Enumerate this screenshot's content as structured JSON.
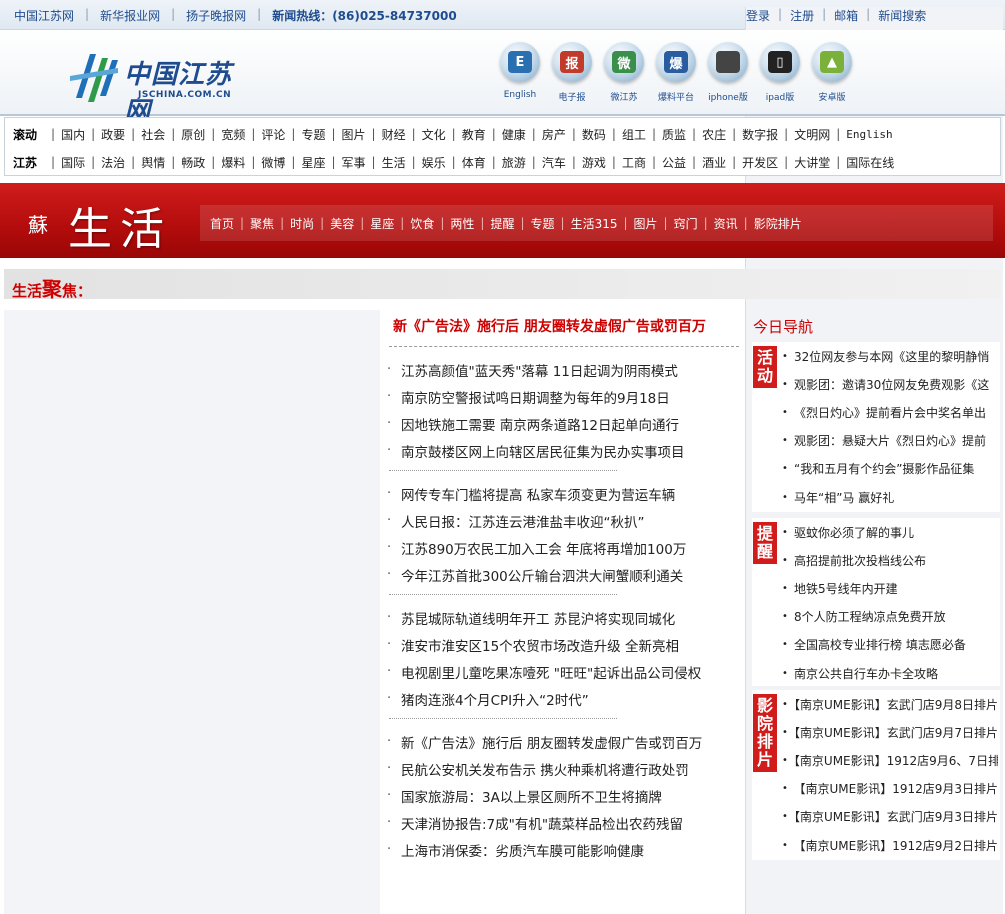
{
  "topbar": {
    "links": [
      "中国江苏网",
      "新华报业网",
      "扬子晚报网"
    ],
    "hotline": "新闻热线：(86)025-84737000",
    "right_links": [
      "登录",
      "注册",
      "邮箱",
      "新闻搜索"
    ]
  },
  "logo": {
    "cn": "中国江苏网",
    "en": "JSCHINA.COM.CN"
  },
  "apps": [
    {
      "label": "English",
      "icon": "english-app-icon",
      "glyph": "E",
      "color": "#2a6fb0"
    },
    {
      "label": "电子报",
      "icon": "epaper-icon",
      "glyph": "报",
      "color": "#c23a2a"
    },
    {
      "label": "微江苏",
      "icon": "weijiangsu-icon",
      "glyph": "微",
      "color": "#3a8f4a"
    },
    {
      "label": "爆料平台",
      "icon": "tipoff-icon",
      "glyph": "爆",
      "color": "#2a5da0"
    },
    {
      "label": "iphone版",
      "icon": "apple-icon",
      "glyph": "",
      "color": "#444444"
    },
    {
      "label": "ipad版",
      "icon": "ipad-icon",
      "glyph": "▯",
      "color": "#222222"
    },
    {
      "label": "安卓版",
      "icon": "android-icon",
      "glyph": "▲",
      "color": "#7bb13a"
    }
  ],
  "nav": {
    "row1_lead": "滚动",
    "row1": [
      "国内",
      "政要",
      "社会",
      "原创",
      "宽频",
      "评论",
      "专题",
      "图片",
      "财经",
      "文化",
      "教育",
      "健康",
      "房产",
      "数码",
      "组工",
      "质监",
      "农庄",
      "数字报",
      "文明网",
      "English"
    ],
    "row2_lead": "江苏",
    "row2": [
      "国际",
      "法治",
      "舆情",
      "畅政",
      "爆料",
      "微博",
      "星座",
      "军事",
      "生活",
      "娱乐",
      "体育",
      "旅游",
      "汽车",
      "游戏",
      "工商",
      "公益",
      "酒业",
      "开发区",
      "大讲堂",
      "国际在线"
    ]
  },
  "banner": {
    "su": "蘇",
    "title": "生活",
    "subnav": [
      "首页",
      "聚焦",
      "时尚",
      "美容",
      "星座",
      "饮食",
      "两性",
      "提醒",
      "专题",
      "生活315",
      "图片",
      "窍门",
      "资讯",
      "影院排片"
    ]
  },
  "focus": {
    "pre": "生活",
    "big": "聚",
    "post": "焦："
  },
  "news": {
    "headline": "新《广告法》施行后  朋友圈转发虚假广告或罚百万",
    "groups": [
      [
        "江苏高颜值\"蓝天秀\"落幕  11日起调为阴雨模式",
        "南京防空警报试鸣日期调整为每年的9月18日",
        "因地铁施工需要  南京两条道路12日起单向通行",
        "南京鼓楼区网上向辖区居民征集为民办实事项目"
      ],
      [
        "网传专车门槛将提高  私家车须变更为营运车辆",
        "人民日报：江苏连云港淮盐丰收迎“秋扒”",
        "江苏890万农民工加入工会  年底将再增加100万",
        "今年江苏首批300公斤输台泗洪大闸蟹顺利通关"
      ],
      [
        "苏昆城际轨道线明年开工  苏昆沪将实现同城化",
        "淮安市淮安区15个农贸市场改造升级  全新亮相",
        "电视剧里儿童吃果冻噎死  \"旺旺\"起诉出品公司侵权",
        "猪肉连涨4个月CPI升入“2时代”"
      ],
      [
        "新《广告法》施行后  朋友圈转发虚假广告或罚百万",
        "民航公安机关发布告示  携火种乘机将遭行政处罚",
        "国家旅游局：3A以上景区厕所不卫生将摘牌",
        "天津消协报告:7成\"有机\"蔬菜样品检出农药残留",
        "上海市消保委：劣质汽车膜可能影响健康"
      ]
    ]
  },
  "today": {
    "title": "今日导航",
    "sections": [
      {
        "tag": "活动",
        "items": [
          "32位网友参与本网《这里的黎明静悄",
          "观影团：邀请30位网友免费观影《这",
          "《烈日灼心》提前看片会中奖名单出",
          "观影团：悬疑大片《烈日灼心》提前",
          "“我和五月有个约会”摄影作品征集",
          "马年“相”马 赢好礼"
        ]
      },
      {
        "tag": "提醒",
        "items": [
          "驱蚊你必须了解的事儿",
          "高招提前批次投档线公布",
          "地铁5号线年内开建",
          "8个人防工程纳凉点免费开放",
          "全国高校专业排行榜 填志愿必备",
          "南京公共自行车办卡全攻略"
        ]
      },
      {
        "tag": "影院排片",
        "items": [
          "【南京UME影讯】玄武门店9月8日排片",
          "【南京UME影讯】玄武门店9月7日排片",
          "【南京UME影讯】1912店9月6、7日排",
          "【南京UME影讯】1912店9月3日排片",
          "【南京UME影讯】玄武门店9月3日排片",
          "【南京UME影讯】1912店9月2日排片"
        ]
      }
    ]
  }
}
